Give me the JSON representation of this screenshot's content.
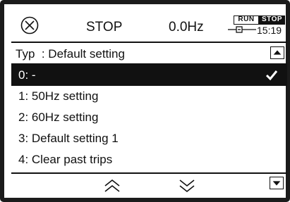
{
  "status": {
    "icon": "circle-x-icon",
    "state": "STOP",
    "frequency": "0.0Hz",
    "run_badge": "RUN",
    "stop_badge": "STOP",
    "time": "15:19"
  },
  "parameter": {
    "title": "Typ  : Default setting"
  },
  "options": [
    {
      "label": "0: -",
      "selected": true
    },
    {
      "label": "1: 50Hz setting",
      "selected": false
    },
    {
      "label": "2: 60Hz setting",
      "selected": false
    },
    {
      "label": "3: Default setting 1",
      "selected": false
    },
    {
      "label": "4: Clear past trips",
      "selected": false
    }
  ],
  "nav": {
    "up_icon": "double-chevron-up-icon",
    "down_icon": "double-chevron-down-icon"
  }
}
